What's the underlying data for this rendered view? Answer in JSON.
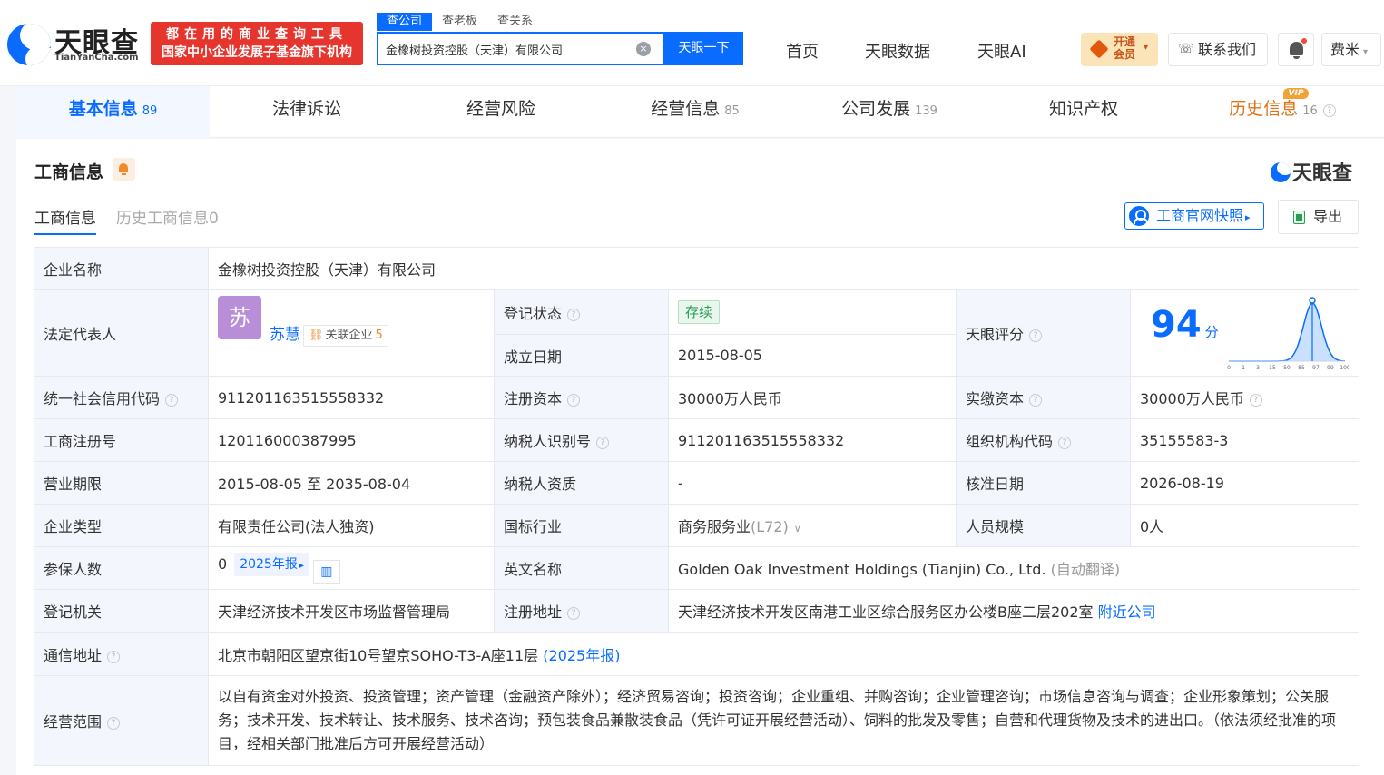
{
  "header": {
    "logo_cn": "天眼查",
    "logo_en": "TianYanCha.com",
    "slogan_line1": "都在用的商业查询工具",
    "slogan_line2": "国家中小企业发展子基金旗下机构",
    "search_tabs": [
      "查公司",
      "查老板",
      "查关系"
    ],
    "search_value": "金橡树投资控股（天津）有限公司",
    "search_button": "天眼一下",
    "nav": [
      "首页",
      "天眼数据",
      "天眼AI"
    ],
    "vip_label": "开通会员",
    "contact_label": "联系我们",
    "user_name": "费米"
  },
  "tabs": [
    {
      "label": "基本信息",
      "count": "89"
    },
    {
      "label": "法律诉讼",
      "count": ""
    },
    {
      "label": "经营风险",
      "count": ""
    },
    {
      "label": "经营信息",
      "count": "85"
    },
    {
      "label": "公司发展",
      "count": "139"
    },
    {
      "label": "知识产权",
      "count": ""
    },
    {
      "label": "历史信息",
      "count": "16"
    }
  ],
  "vip_tag": "VIP",
  "panel": {
    "title": "工商信息",
    "brand": "天眼查",
    "subtabs": [
      "工商信息",
      "历史工商信息0"
    ],
    "snapshot_button": "工商官网快照",
    "export_button": "导出"
  },
  "info": {
    "company_name_label": "企业名称",
    "company_name": "金橡树投资控股（天津）有限公司",
    "legal_rep_label": "法定代表人",
    "legal_rep_avatar": "苏",
    "legal_rep_name": "苏慧",
    "related_label": "关联企业",
    "related_count": "5",
    "status_label": "登记状态",
    "status": "存续",
    "found_date_label": "成立日期",
    "found_date": "2015-08-05",
    "score_label": "天眼评分",
    "score": "94",
    "score_unit": "分",
    "credit_code_label": "统一社会信用代码",
    "credit_code": "911201163515558332",
    "reg_capital_label": "注册资本",
    "reg_capital": "30000万人民币",
    "paid_capital_label": "实缴资本",
    "paid_capital": "30000万人民币",
    "reg_no_label": "工商注册号",
    "reg_no": "120116000387995",
    "taxpayer_id_label": "纳税人识别号",
    "taxpayer_id": "911201163515558332",
    "org_code_label": "组织机构代码",
    "org_code": "35155583-3",
    "term_label": "营业期限",
    "term": "2015-08-05 至 2035-08-04",
    "tax_qual_label": "纳税人资质",
    "tax_qual": "-",
    "approve_date_label": "核准日期",
    "approve_date": "2026-08-19",
    "type_label": "企业类型",
    "type": "有限责任公司(法人独资)",
    "industry_label": "国标行业",
    "industry": "商务服务业",
    "industry_code": "(L72)",
    "staff_label": "人员规模",
    "staff": "0人",
    "insured_label": "参保人数",
    "insured": "0",
    "insured_report": "2025年报",
    "en_name_label": "英文名称",
    "en_name": "Golden Oak Investment Holdings (Tianjin) Co., Ltd.",
    "en_name_note": "(自动翻译)",
    "authority_label": "登记机关",
    "authority": "天津经济技术开发区市场监督管理局",
    "address_label": "注册地址",
    "address": "天津经济技术开发区南港工业区综合服务区办公楼B座二层202室",
    "nearby": "附近公司",
    "mail_label": "通信地址",
    "mail": "北京市朝阳区望京街10号望京SOHO-T3-A座11层",
    "mail_report": "(2025年报)",
    "scope_label": "经营范围",
    "scope": "以自有资金对外投资、投资管理；资产管理（金融资产除外）；经济贸易咨询；投资咨询；企业重组、并购咨询；企业管理咨询；市场信息咨询与调查；企业形象策划；公关服务；技术开发、技术转让、技术服务、技术咨询；预包装食品兼散装食品（凭许可证开展经营活动）、饲料的批发及零售；自营和代理货物及技术的进出口。（依法须经批准的项目，经相关部门批准后方可开展经营活动）"
  },
  "score_chart": {
    "x_ticks": [
      "0",
      "1",
      "3",
      "15",
      "50",
      "85",
      "97",
      "99",
      "100"
    ],
    "marker": 94,
    "colors": {
      "accent": "#0a6cff",
      "fill": "#bcd8ff"
    }
  }
}
